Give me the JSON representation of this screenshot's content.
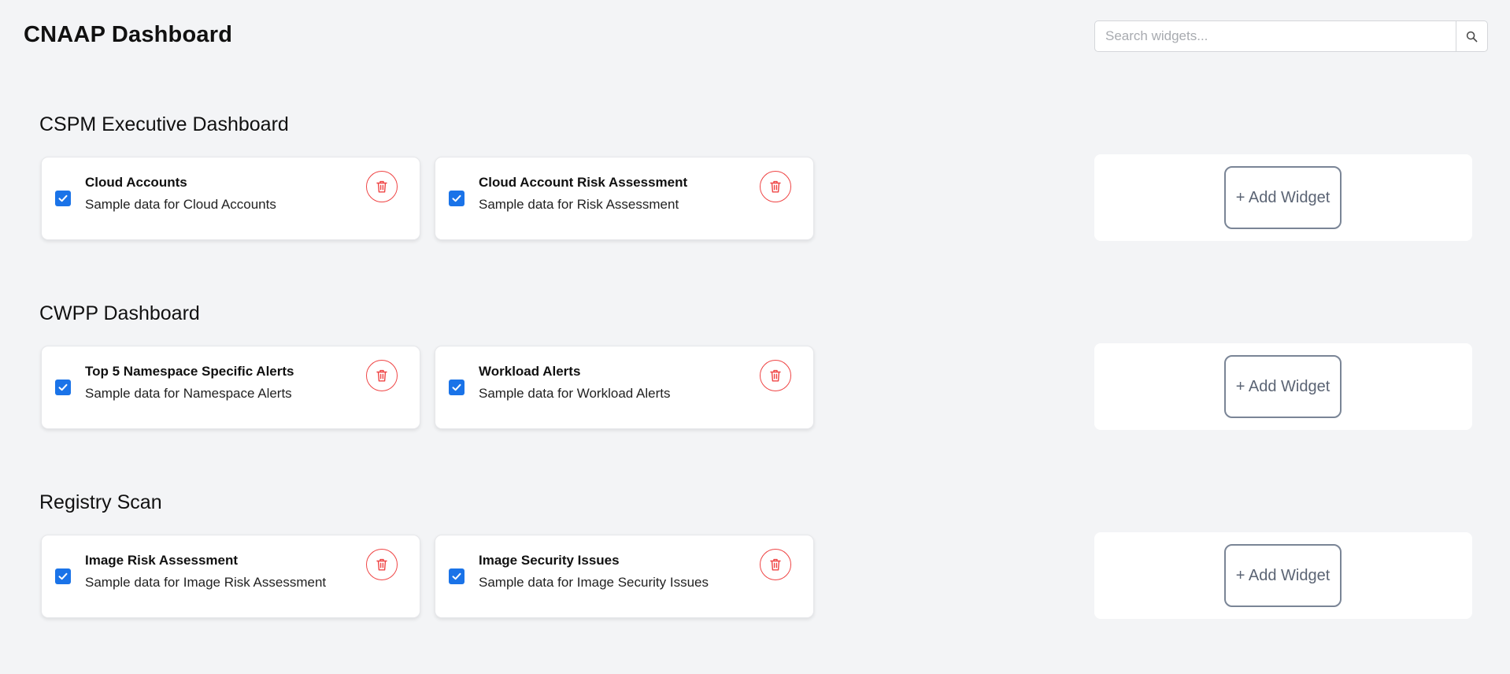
{
  "header": {
    "title": "CNAAP Dashboard",
    "search_placeholder": "Search widgets...",
    "search_value": ""
  },
  "sections": [
    {
      "title": "CSPM Executive Dashboard",
      "widgets": [
        {
          "title": "Cloud Accounts",
          "subtitle": "Sample data for Cloud Accounts",
          "checked": true
        },
        {
          "title": "Cloud Account Risk Assessment",
          "subtitle": "Sample data for Risk Assessment",
          "checked": true
        }
      ],
      "add_label": "+ Add Widget"
    },
    {
      "title": "CWPP Dashboard",
      "widgets": [
        {
          "title": "Top 5 Namespace Specific Alerts",
          "subtitle": "Sample data for Namespace Alerts",
          "checked": true
        },
        {
          "title": "Workload Alerts",
          "subtitle": "Sample data for Workload Alerts",
          "checked": true
        }
      ],
      "add_label": "+ Add Widget"
    },
    {
      "title": "Registry Scan",
      "widgets": [
        {
          "title": "Image Risk Assessment",
          "subtitle": "Sample data for Image Risk Assessment",
          "checked": true
        },
        {
          "title": "Image Security Issues",
          "subtitle": "Sample data for Image Security Issues",
          "checked": true
        }
      ],
      "add_label": "+ Add Widget"
    }
  ],
  "colors": {
    "checkbox": "#1a73e8",
    "delete": "#ef4444",
    "add_border": "#7a8596",
    "background": "#f3f4f6"
  },
  "icons": [
    "search-icon",
    "check-icon",
    "trash-icon"
  ]
}
